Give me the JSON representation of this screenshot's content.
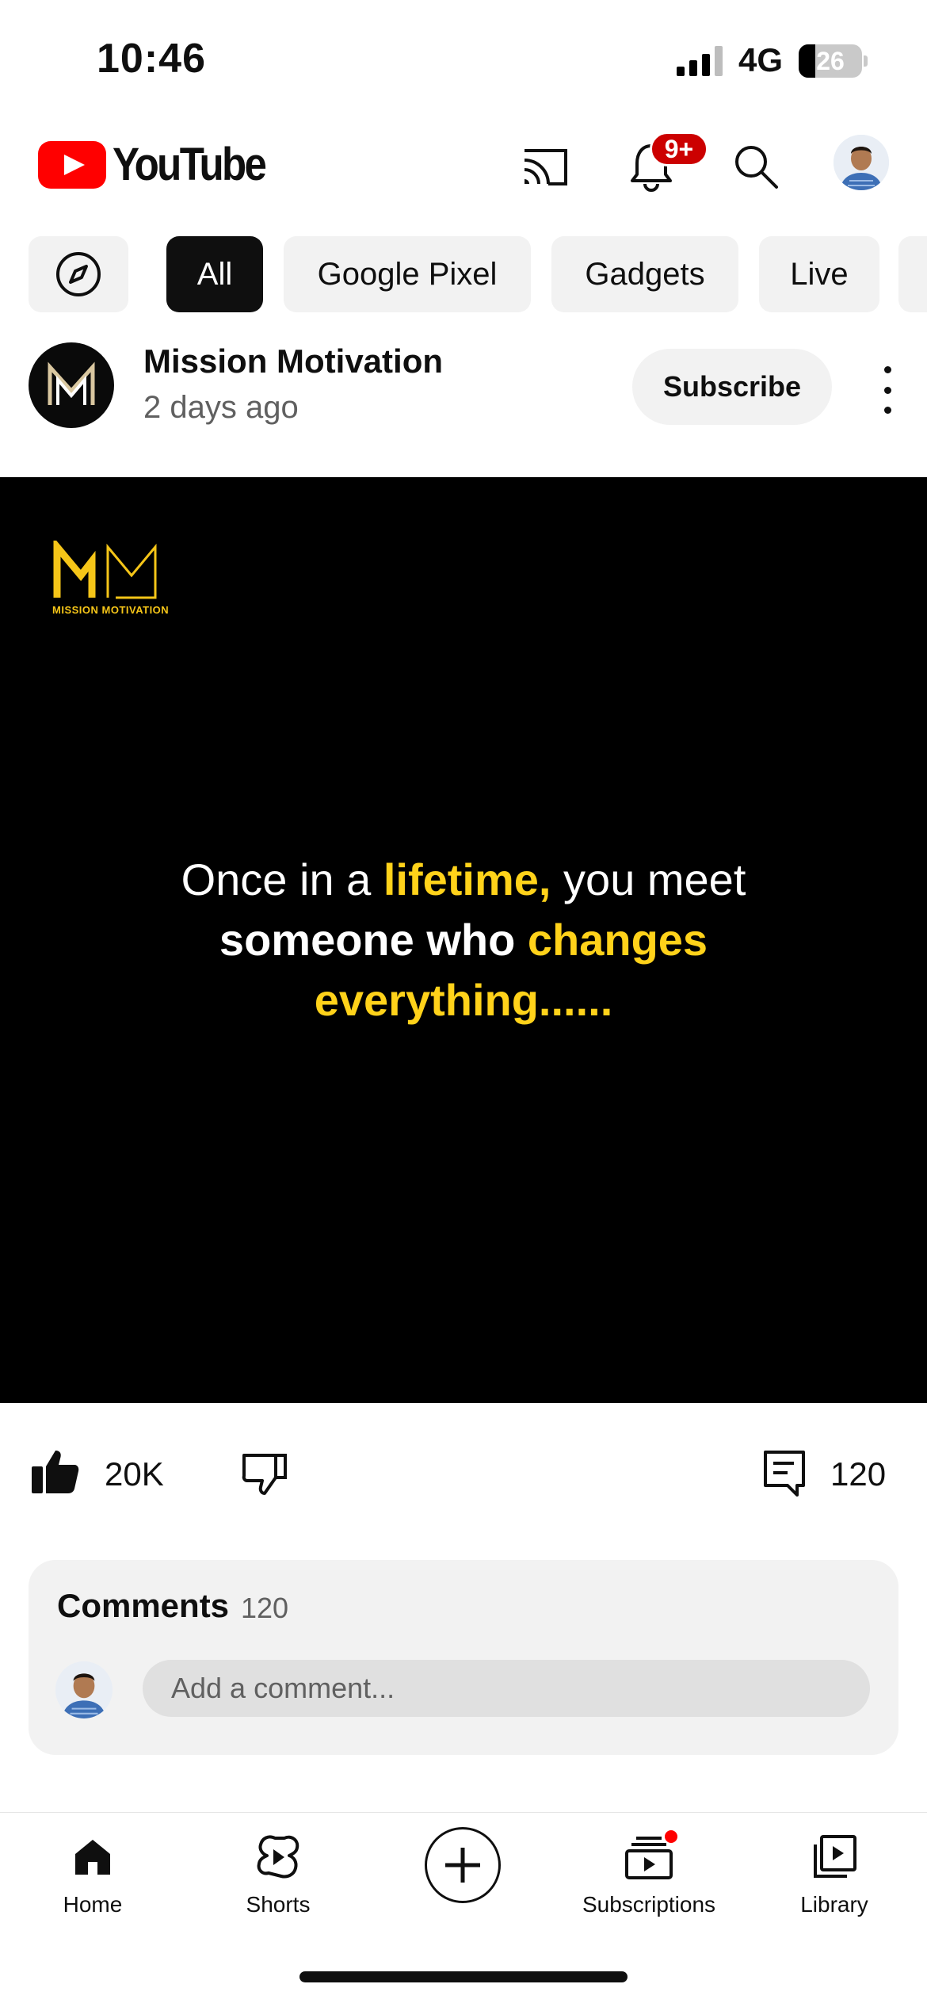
{
  "status_bar": {
    "time": "10:46",
    "network": "4G",
    "battery_level": "26"
  },
  "header": {
    "logo_text": "YouTube",
    "notification_badge": "9+"
  },
  "chips": [
    "All",
    "Google Pixel",
    "Gadgets",
    "Live"
  ],
  "post": {
    "channel_name": "Mission Motivation",
    "posted": "2 days ago",
    "subscribe_label": "Subscribe",
    "image": {
      "logo_text": "MM",
      "logo_caption": "MISSION MOTIVATION",
      "quote_line1_a": "Once in a ",
      "quote_line1_b": "lifetime,",
      "quote_line1_c": " you meet",
      "quote_line2_a": "someone who ",
      "quote_line2_b": "changes",
      "quote_line3": "everything......"
    },
    "likes": "20K",
    "comments_count": "120"
  },
  "comments": {
    "title": "Comments",
    "count": "120",
    "placeholder": "Add a comment..."
  },
  "bottom_nav": {
    "home": "Home",
    "shorts": "Shorts",
    "subscriptions": "Subscriptions",
    "library": "Library"
  },
  "colors": {
    "brand_red": "#ff0000",
    "quote_highlight": "#ffd21a",
    "chip_bg": "#f2f2f2"
  }
}
